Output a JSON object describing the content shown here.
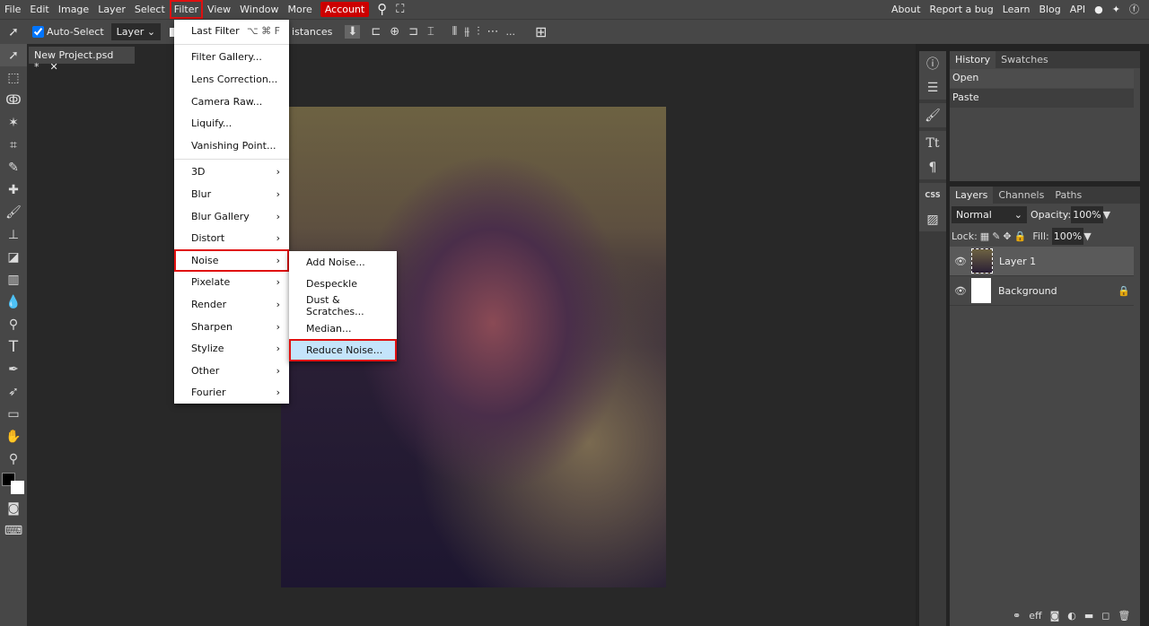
{
  "menubar": {
    "items": [
      "File",
      "Edit",
      "Image",
      "Layer",
      "Select",
      "Filter",
      "View",
      "Window",
      "More"
    ],
    "account": "Account",
    "right": [
      "About",
      "Report a bug",
      "Learn",
      "Blog",
      "API"
    ]
  },
  "toolbar": {
    "auto_select": "Auto-Select",
    "layer_select": "Layer",
    "distances": "istances",
    "more": "..."
  },
  "document_tab": {
    "title": "New Project.psd *"
  },
  "filter_menu": {
    "last_filter": "Last Filter",
    "last_filter_shortcut": "⌥ ⌘ F",
    "group1": [
      "Filter Gallery...",
      "Lens Correction...",
      "Camera Raw...",
      "Liquify...",
      "Vanishing Point..."
    ],
    "group2": [
      "3D",
      "Blur",
      "Blur Gallery",
      "Distort",
      "Noise",
      "Pixelate",
      "Render",
      "Sharpen",
      "Stylize",
      "Other",
      "Fourier"
    ]
  },
  "noise_submenu": {
    "items": [
      "Add Noise...",
      "Despeckle",
      "Dust & Scratches...",
      "Median...",
      "Reduce Noise..."
    ]
  },
  "history_panel": {
    "tabs": [
      "History",
      "Swatches"
    ],
    "items": [
      "Open",
      "Paste"
    ]
  },
  "layers_panel": {
    "tabs": [
      "Layers",
      "Channels",
      "Paths"
    ],
    "blend_mode": "Normal",
    "opacity_label": "Opacity:",
    "opacity": "100%",
    "lock_label": "Lock:",
    "fill_label": "Fill:",
    "fill": "100%",
    "layers": [
      "Layer 1",
      "Background"
    ],
    "footer_eff": "eff"
  },
  "icon_column": {
    "css": "CSS"
  }
}
